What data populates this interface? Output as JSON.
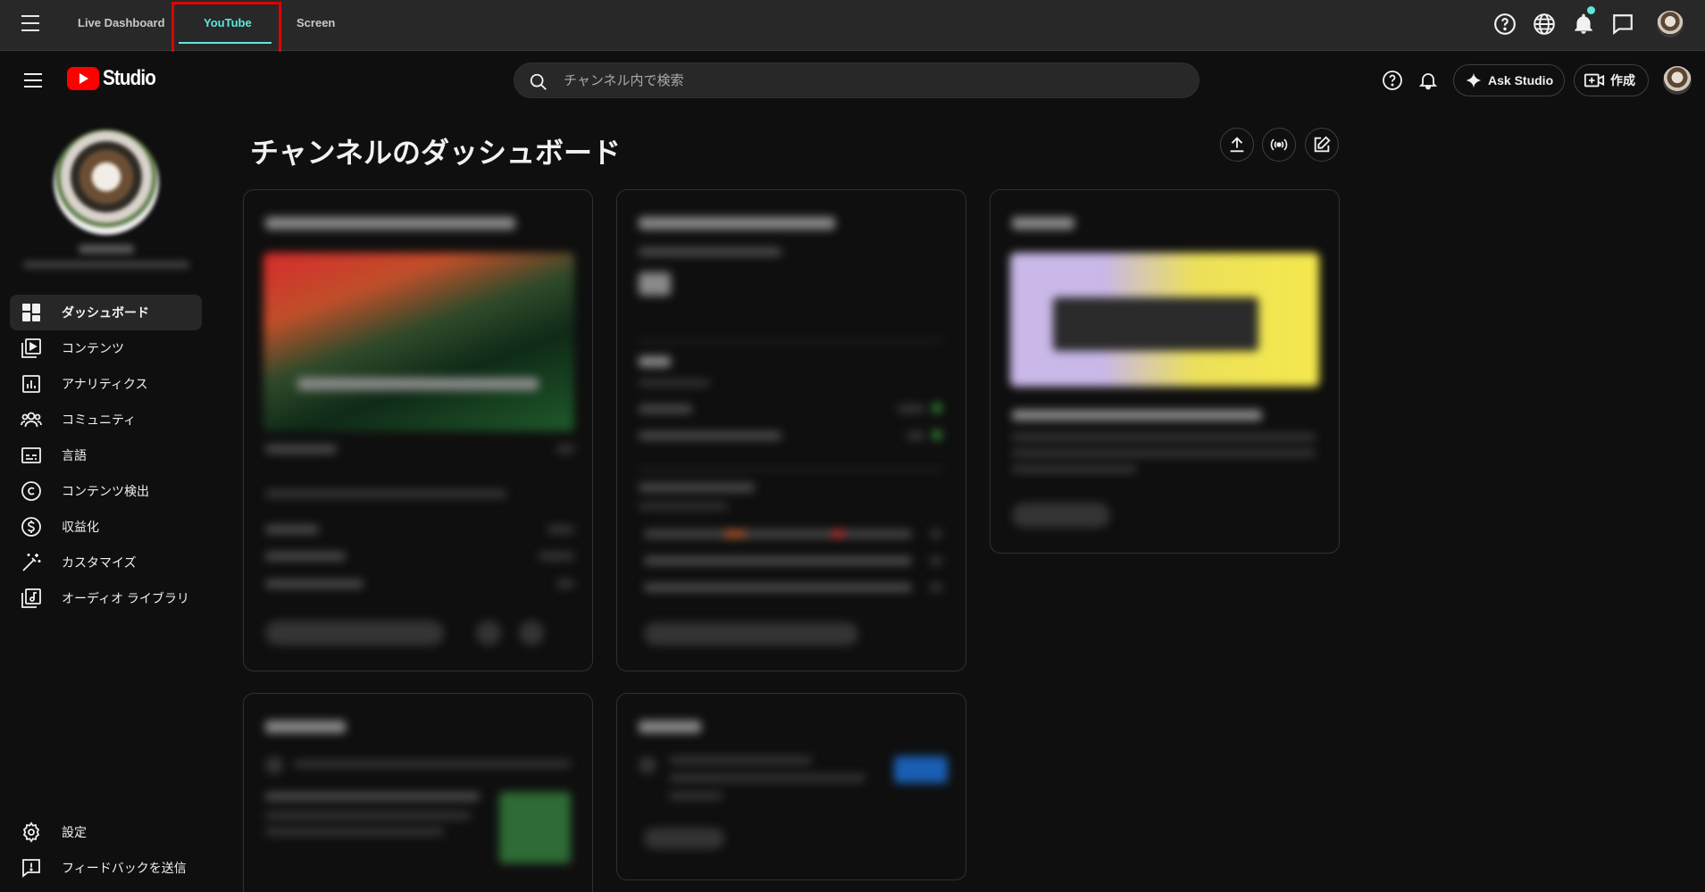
{
  "outer_bar": {
    "tabs": [
      "Live Dashboard",
      "YouTube",
      "Screen"
    ],
    "icons": [
      "help-circle-icon",
      "globe-icon",
      "bell-icon",
      "chat-icon",
      "avatar"
    ],
    "accent": "#5fe7dc",
    "highlight_color": "#e00000"
  },
  "studio_header": {
    "logo_text": "Studio",
    "search_placeholder": "チャンネル内で検索",
    "ask_studio_label": "Ask Studio",
    "create_label": "作成"
  },
  "sidebar": {
    "items": [
      {
        "label": "ダッシュボード",
        "icon": "dashboard-icon",
        "active": true
      },
      {
        "label": "コンテンツ",
        "icon": "content-icon"
      },
      {
        "label": "アナリティクス",
        "icon": "analytics-icon"
      },
      {
        "label": "コミュニティ",
        "icon": "community-icon"
      },
      {
        "label": "言語",
        "icon": "subtitles-icon"
      },
      {
        "label": "コンテンツ検出",
        "icon": "copyright-icon"
      },
      {
        "label": "収益化",
        "icon": "dollar-icon"
      },
      {
        "label": "カスタマイズ",
        "icon": "magic-wand-icon"
      },
      {
        "label": "オーディオ ライブラリ",
        "icon": "audio-library-icon"
      }
    ],
    "bottom_items": [
      {
        "label": "設定",
        "icon": "gear-icon"
      },
      {
        "label": "フィードバックを送信",
        "icon": "feedback-icon"
      }
    ]
  },
  "main": {
    "page_title": "チャンネルのダッシュボード",
    "actions": [
      "upload-icon",
      "live-icon",
      "edit-post-icon"
    ]
  },
  "colors": {
    "background": "#0f0f0f",
    "brand_red": "#ff0000",
    "card_border": "#303030"
  }
}
